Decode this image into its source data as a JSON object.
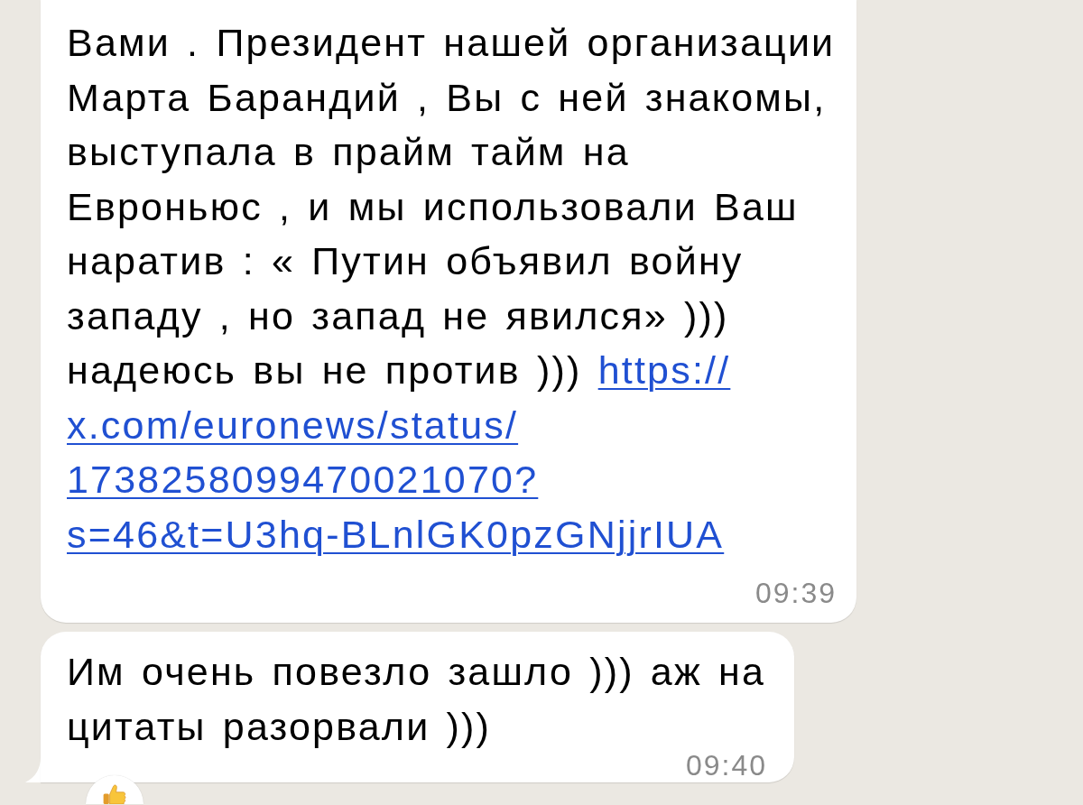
{
  "messages": [
    {
      "text": "Вами . Президент нашей организации Марта Барандий , Вы с ней знакомы, выступала в прайм тайм на\nЕвроньюс , и мы использовали Ваш наратив : « Путин объявил войну западу , но запад не явился» ))) надеюсь вы не против )))",
      "link_lines": [
        "https://",
        "x.com/euronews/status/",
        "1738258099470021070?",
        "s=46&t=U3hq-BLnlGK0pzGNjjrIUA"
      ],
      "time": "09:39",
      "tail": false
    },
    {
      "text": "Им очень повезло зашло ))) аж на цитаты разорвали )))",
      "time": "09:40",
      "tail": true,
      "reactions": [
        {
          "kind": "thumbs_up"
        }
      ]
    }
  ]
}
